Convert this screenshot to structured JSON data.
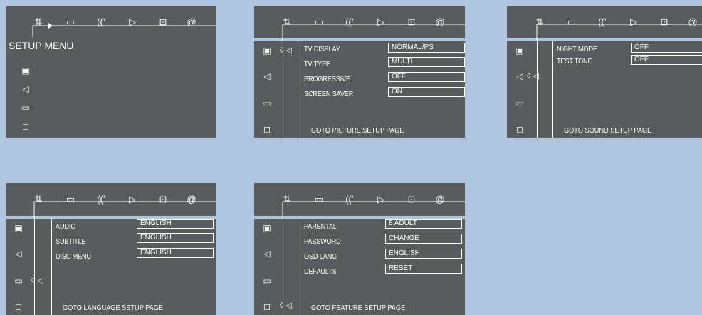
{
  "top_icons": [
    "⇅",
    "▭",
    "((ʼ",
    "▷",
    "⊡",
    "@"
  ],
  "side_icons": [
    "person-icon",
    "speaker-icon",
    "chat-icon",
    "briefcase-icon"
  ],
  "panel1": {
    "title": "SETUP MENU"
  },
  "panel2": {
    "rows": [
      {
        "label": "TV DISPLAY",
        "value": "NORMAL/PS"
      },
      {
        "label": "TV TYPE",
        "value": "MULTI"
      },
      {
        "label": "PROGRESSIVE",
        "value": "OFF"
      },
      {
        "label": "SCREEN SAVER",
        "value": "ON"
      }
    ],
    "goto": "GOTO PICTURE SETUP PAGE"
  },
  "panel3": {
    "rows": [
      {
        "label": "NIGHT MODE",
        "value": "OFF"
      },
      {
        "label": "TEST TONE",
        "value": "OFF"
      }
    ],
    "goto": "GOTO SOUND SETUP PAGE"
  },
  "panel4": {
    "rows": [
      {
        "label": "AUDIO",
        "value": "ENGLISH"
      },
      {
        "label": "SUBTITLE",
        "value": "ENGLISH"
      },
      {
        "label": "DISC MENU",
        "value": "ENGLISH"
      }
    ],
    "goto": "GOTO LANGUAGE SETUP PAGE"
  },
  "panel5": {
    "rows": [
      {
        "label": "PARENTAL",
        "value": "8 ADULT"
      },
      {
        "label": "PASSWORD",
        "value": "CHANGE"
      },
      {
        "label": "OSD LANG",
        "value": "ENGLISH"
      },
      {
        "label": "DEFAULTS",
        "value": "RESET"
      }
    ],
    "goto": "GOTO FEATURE SETUP PAGE"
  }
}
